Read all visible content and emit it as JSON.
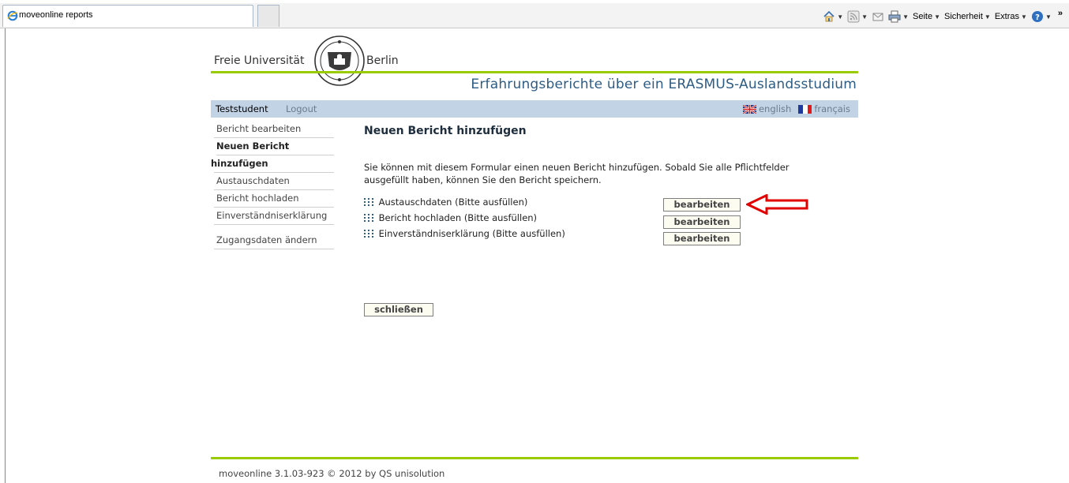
{
  "browser": {
    "tab_title": "moveonline reports",
    "toolbar": {
      "page_label": "Seite",
      "security_label": "Sicherheit",
      "extras_label": "Extras"
    }
  },
  "header": {
    "logo_left": "Freie Universität",
    "logo_right": "Berlin",
    "site_title": "Erfahrungsberichte über ein ERASMUS-Auslandsstudium"
  },
  "userbar": {
    "username": "Teststudent",
    "logout": "Logout",
    "lang_english": "english",
    "lang_french": "français"
  },
  "sidebar": {
    "items": [
      {
        "label": "Bericht bearbeiten"
      },
      {
        "label_line1": "Neuen Bericht",
        "label_line2": "hinzufügen"
      },
      {
        "label": "Austauschdaten"
      },
      {
        "label": "Bericht hochladen"
      },
      {
        "label": "Einverständniserklärung"
      },
      {
        "label": "Zugangsdaten ändern"
      }
    ]
  },
  "main": {
    "title": "Neuen Bericht hinzufügen",
    "intro_line1": "Sie können mit diesem Formular einen neuen Bericht hinzufügen. Sobald Sie alle Pflichtfelder",
    "intro_line2": "ausgefüllt haben, können Sie den Bericht speichern.",
    "sections": [
      {
        "label": "Austauschdaten (Bitte ausfüllen)",
        "button": "bearbeiten"
      },
      {
        "label": "Bericht hochladen (Bitte ausfüllen)",
        "button": "bearbeiten"
      },
      {
        "label": "Einverständniserklärung (Bitte ausfüllen)",
        "button": "bearbeiten"
      }
    ],
    "close_button": "schließen"
  },
  "footer": {
    "text": "moveonline 3.1.03-923 © 2012 by QS unisolution"
  },
  "colors": {
    "accent_green": "#99cc00",
    "userbar_blue": "#c2d3e6",
    "title_blue": "#2d5c84",
    "annotation_red": "#e00000"
  }
}
